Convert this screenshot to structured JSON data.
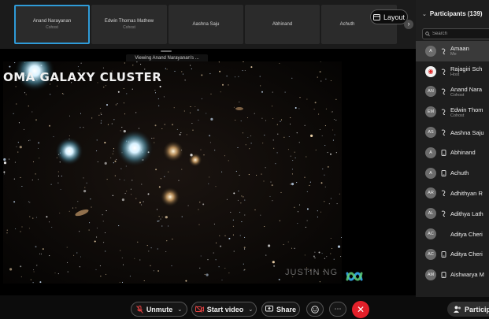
{
  "thumbnails": [
    {
      "name": "Anand Narayanan",
      "role": "Cohost",
      "active": true
    },
    {
      "name": "Edwin Thomas Mathew",
      "role": "Cohost",
      "active": false
    },
    {
      "name": "Aashna Saju",
      "role": "",
      "active": false
    },
    {
      "name": "Abhinand",
      "role": "",
      "active": false
    },
    {
      "name": "Achuth",
      "role": "",
      "active": false
    }
  ],
  "layout_button": {
    "label": "Layout",
    "icon": "layout-icon"
  },
  "viewing_label": "Viewing Anand Narayanan's ...",
  "shared_content": {
    "title": "OMA GALAXY CLUSTER",
    "watermark": "JUSTIN NG"
  },
  "toolbar": {
    "unmute_label": "Unmute",
    "start_video_label": "Start video",
    "share_label": "Share",
    "participants_label": "Particip"
  },
  "panel": {
    "title": "Participants (139)",
    "search_placeholder": "Search",
    "participants": [
      {
        "initials": "A",
        "name": "Amaan",
        "role": "Me",
        "status": "audio",
        "highlight": true
      },
      {
        "initials": "",
        "name": "Rajagiri Sch",
        "role": "Host",
        "status": "audio",
        "highlight": false
      },
      {
        "initials": "AN",
        "name": "Anand Nara",
        "role": "Cohost",
        "status": "audio",
        "highlight": false
      },
      {
        "initials": "EM",
        "name": "Edwin Thom",
        "role": "Cohost",
        "status": "audio",
        "highlight": false
      },
      {
        "initials": "AS",
        "name": "Aashna Saju",
        "role": "",
        "status": "audio",
        "highlight": false
      },
      {
        "initials": "A",
        "name": "Abhinand",
        "role": "",
        "status": "device",
        "highlight": false
      },
      {
        "initials": "A",
        "name": "Achuth",
        "role": "",
        "status": "device",
        "highlight": false
      },
      {
        "initials": "AR",
        "name": "Adhithyan R",
        "role": "",
        "status": "audio",
        "highlight": false
      },
      {
        "initials": "AL",
        "name": "Adithya Lath",
        "role": "",
        "status": "audio",
        "highlight": false
      },
      {
        "initials": "AC",
        "name": "Aditya Cheri",
        "role": "",
        "status": "none",
        "highlight": false
      },
      {
        "initials": "AC",
        "name": "Aditya Cheri",
        "role": "",
        "status": "device",
        "highlight": false
      },
      {
        "initials": "AM",
        "name": "Aishwarya M",
        "role": "",
        "status": "device",
        "highlight": false
      }
    ]
  },
  "colors": {
    "accent_blue": "#2f9bd8",
    "end_red": "#e3202a",
    "panel_bg": "#1e1e1e"
  }
}
